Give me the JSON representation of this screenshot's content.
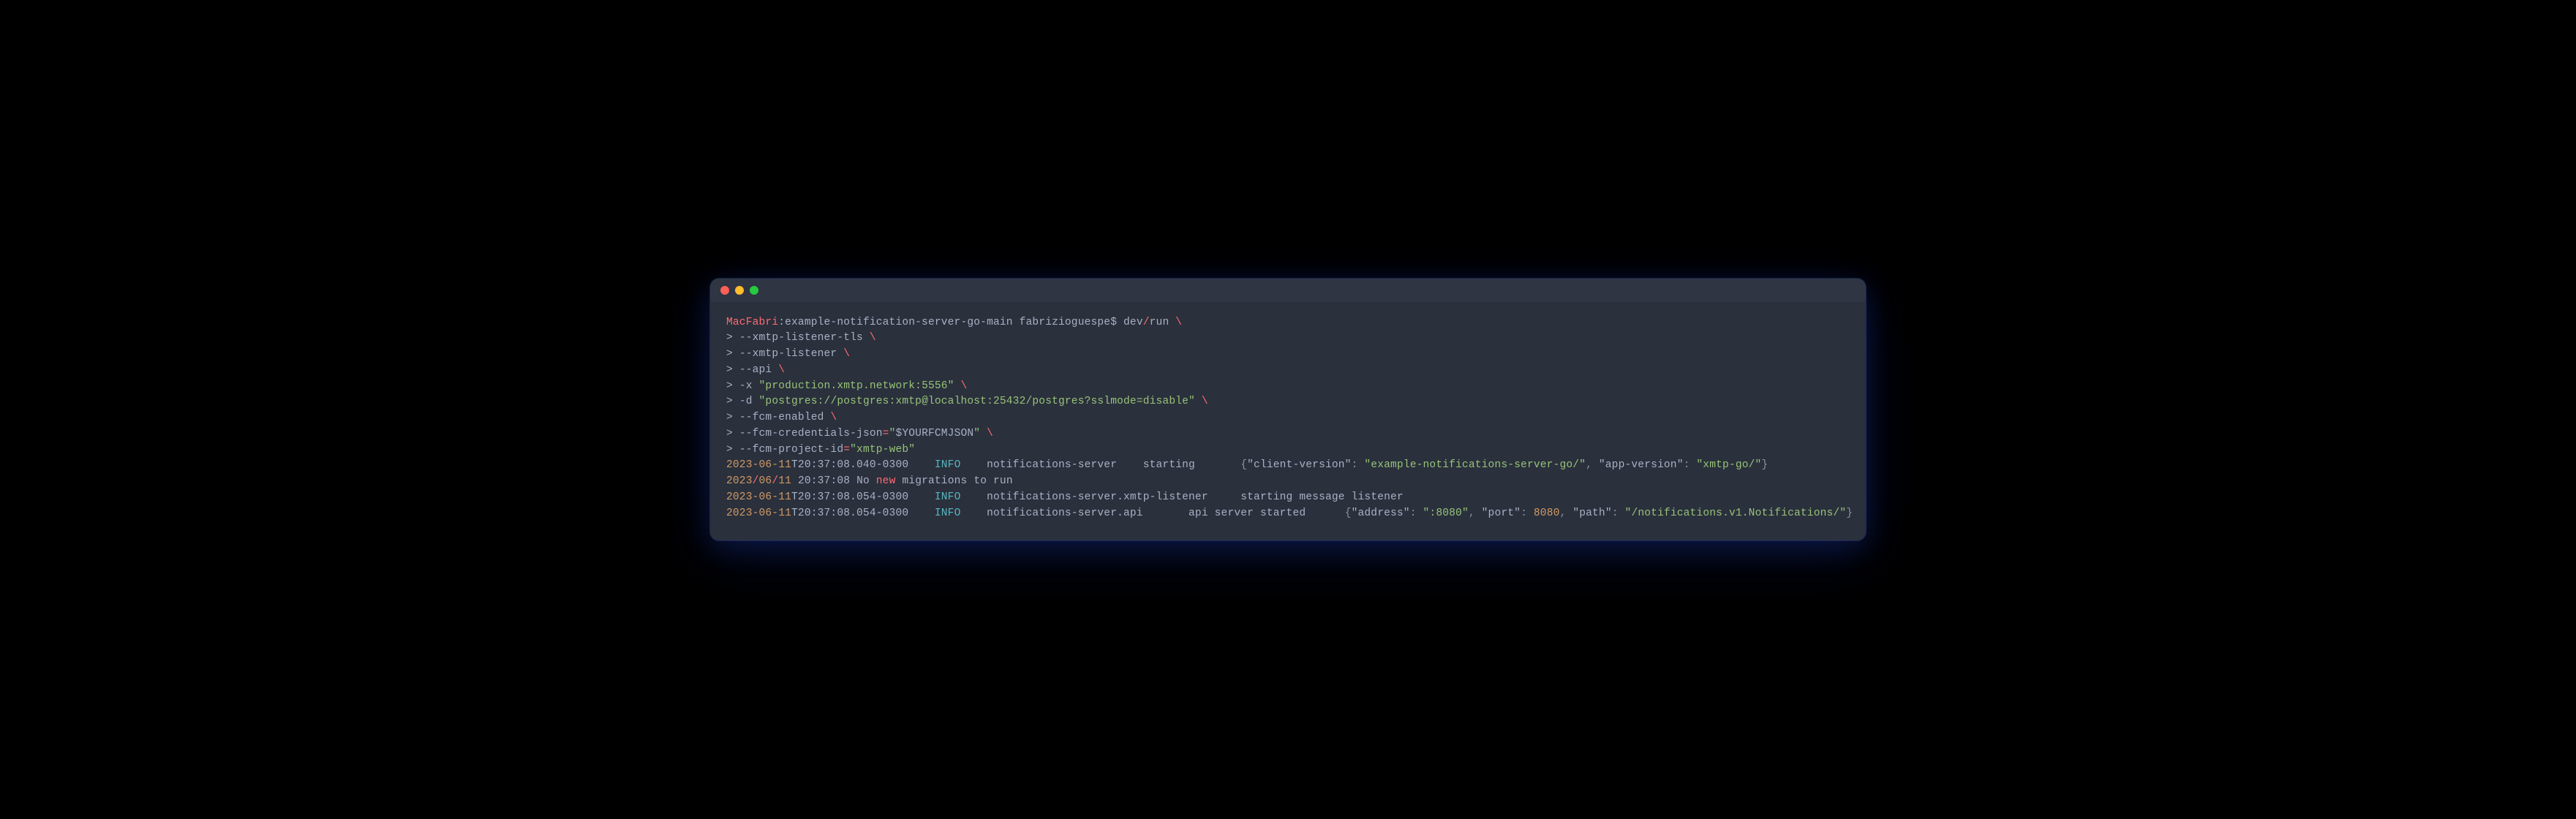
{
  "prompt": {
    "host": "MacFabri",
    "sep1": ":",
    "path": "example-notification-server-go-main",
    "user": " fabrizioguespe$ ",
    "cmd_prefix": "dev",
    "cmd_slash": "/",
    "cmd_name": "run ",
    "backslash": "\\"
  },
  "lines": {
    "l1_gt": "> ",
    "l1_flag": "--xmtp-listener-tls ",
    "l2_flag": "--xmtp-listener ",
    "l3_flag": "--api ",
    "l4_flag": "-x ",
    "l4_val": "\"production.xmtp.network:5556\"",
    "l4_sp": " ",
    "l5_flag": "-d ",
    "l5_val": "\"postgres://postgres:xmtp@localhost:25432/postgres?sslmode=disable\"",
    "l6_flag": "--fcm-enabled ",
    "l7_flag": "--fcm-credentials-json",
    "l7_eq": "=",
    "l7_q": "\"",
    "l7_var": "$YOURFCMJSON",
    "l7_sp": " ",
    "l8_flag": "--fcm-project-id",
    "l8_eq": "=",
    "l8_val": "\"xmtp-web\""
  },
  "log1": {
    "date": "2023-06-11",
    "t": "T20:37:08.040-0300",
    "spacer1": "    ",
    "level": "INFO",
    "spacer2": "    ",
    "src": "notifications-server",
    "spacer3": "    ",
    "msg": "starting",
    "spacer4": "       ",
    "br_open": "{",
    "k1": "\"client-version\"",
    "colon": ": ",
    "v1": "\"example-notifications-server-go/\"",
    "comma": ", ",
    "k2": "\"app-version\"",
    "v2": "\"xmtp-go/\"",
    "br_close": "}"
  },
  "log2": {
    "date_a": "2023",
    "slash": "/",
    "date_b": "06",
    "date_c": "11",
    "time": " 20:37:08 ",
    "no": "No ",
    "new": "new",
    "rest": " migrations to run"
  },
  "log3": {
    "date": "2023-06-11",
    "t": "T20:37:08.054-0300",
    "spacer1": "    ",
    "level": "INFO",
    "spacer2": "    ",
    "src": "notifications-server.xmtp-listener",
    "spacer3": "     ",
    "msg": "starting message listener"
  },
  "log4": {
    "date": "2023-06-11",
    "t": "T20:37:08.054-0300",
    "spacer1": "    ",
    "level": "INFO",
    "spacer2": "    ",
    "src": "notifications-server.api",
    "spacer3": "       ",
    "msg": "api server started",
    "spacer4": "      ",
    "br_open": "{",
    "k1": "\"address\"",
    "colon": ": ",
    "v1": "\":8080\"",
    "comma": ", ",
    "k2": "\"port\"",
    "v2": "8080",
    "k3": "\"path\"",
    "v3": "\"/notifications.v1.Notifications/\"",
    "br_close": "}"
  }
}
